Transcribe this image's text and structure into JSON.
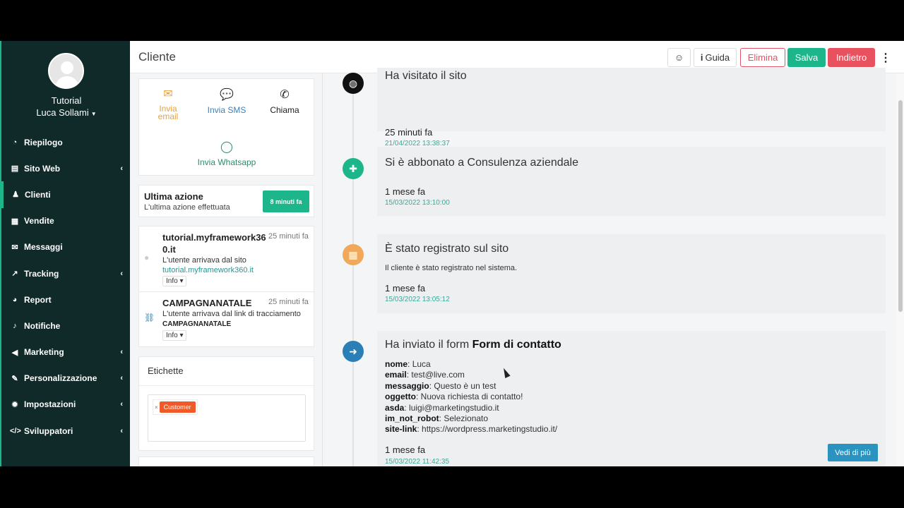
{
  "sidebar": {
    "org": "Tutorial",
    "user": "Luca Sollami",
    "items": [
      {
        "label": "Riepilogo",
        "icon": "dashboard-icon",
        "glyph": "◔",
        "chevron": false
      },
      {
        "label": "Sito Web",
        "icon": "file-icon",
        "glyph": "▤",
        "chevron": true
      },
      {
        "label": "Clienti",
        "icon": "user-icon",
        "glyph": "♟",
        "chevron": false,
        "active": true
      },
      {
        "label": "Vendite",
        "icon": "calculator-icon",
        "glyph": "▦",
        "chevron": false
      },
      {
        "label": "Messaggi",
        "icon": "envelope-icon",
        "glyph": "✉",
        "chevron": false
      },
      {
        "label": "Tracking",
        "icon": "chart-icon",
        "glyph": "↗",
        "chevron": true
      },
      {
        "label": "Report",
        "icon": "pie-chart-icon",
        "glyph": "◕",
        "chevron": false
      },
      {
        "label": "Notifiche",
        "icon": "bell-icon",
        "glyph": "♪",
        "chevron": false
      },
      {
        "label": "Marketing",
        "icon": "megaphone-icon",
        "glyph": "◀",
        "chevron": true
      },
      {
        "label": "Personalizzazione",
        "icon": "brush-icon",
        "glyph": "✎",
        "chevron": true
      },
      {
        "label": "Impostazioni",
        "icon": "gear-icon",
        "glyph": "✹",
        "chevron": true
      },
      {
        "label": "Sviluppatori",
        "icon": "code-icon",
        "glyph": "</>",
        "chevron": true
      }
    ]
  },
  "header": {
    "title": "Cliente",
    "guida": "Guida",
    "elimina": "Elimina",
    "salva": "Salva",
    "indietro": "Indietro"
  },
  "contact": {
    "email": "Invia email",
    "sms": "Invia SMS",
    "call": "Chiama",
    "whatsapp": "Invia Whatsapp"
  },
  "last_action": {
    "title": "Ultima azione",
    "subtitle": "L'ultima azione effettuata",
    "badge": "8 minuti fa"
  },
  "visits": [
    {
      "title": "tutorial.myframework360.it",
      "time": "25 minuti fa",
      "desc": "L'utente arrivava dal sito",
      "link": "tutorial.myframework360.it",
      "info": "Info ▾"
    },
    {
      "title": "CAMPAGNANATALE",
      "time": "25 minuti fa",
      "desc": "L'utente arrivava dal link di tracciamento",
      "strong": "CAMPAGNANATALE",
      "info": "Info ▾"
    }
  ],
  "tags": {
    "title": "Etichette",
    "items": [
      "Customer"
    ]
  },
  "timeline": [
    {
      "title": "Ha visitato il sito",
      "relative": "25 minuti fa",
      "date": "21/04/2022 13:38:37",
      "color": "#111111",
      "icon": "globe-icon"
    },
    {
      "title": "Si è abbonato a Consulenza aziendale",
      "relative": "1 mese fa",
      "date": "15/03/2022 13:10:00",
      "color": "#1db58a",
      "icon": "user-plus-icon"
    },
    {
      "title": "È stato registrato sul sito",
      "text": "Il cliente è stato registrato nel sistema.",
      "relative": "1 mese fa",
      "date": "15/03/2022 13:05:12",
      "color": "#f0a95b",
      "icon": "calendar-icon"
    },
    {
      "title_prefix": "Ha inviato il form ",
      "title_bold": "Form di contatto",
      "fields": [
        {
          "k": "nome",
          "v": "Luca"
        },
        {
          "k": "email",
          "v": "test@live.com"
        },
        {
          "k": "messaggio",
          "v": "Questo è un test"
        },
        {
          "k": "oggetto",
          "v": "Nuova richiesta di contatto!"
        },
        {
          "k": "asda",
          "v": "luigi@marketingstudio.it"
        },
        {
          "k": "im_not_robot",
          "v": "Selezionato"
        },
        {
          "k": "site-link",
          "v": "https://wordpress.marketingstudio.it/"
        }
      ],
      "relative": "1 mese fa",
      "date": "15/03/2022 11:42:35",
      "button": "Vedi di più",
      "color": "#2a7fb6",
      "icon": "arrow-right-circle-icon"
    }
  ]
}
